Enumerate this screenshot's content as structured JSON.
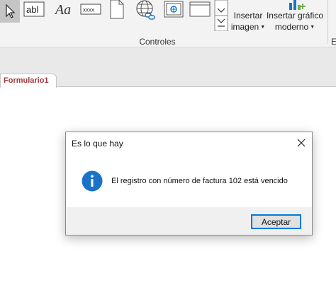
{
  "ribbon": {
    "label_tool_text": "abl",
    "text_tool_text": "Aa",
    "textbox_tool_text": "xxxx",
    "insert_image": {
      "line1": "Insertar",
      "line2": "imagen"
    },
    "insert_chart": {
      "line1": "Insertar gráfico",
      "line2": "moderno"
    },
    "group_label": "Controles",
    "next_group_label": "E",
    "accent_color": "#a4373a"
  },
  "document": {
    "tab_label": "Formulario1"
  },
  "dialog": {
    "title": "Es lo que hay",
    "message": "El registro con número de factura 102 está vencido",
    "ok_label": "Aceptar",
    "icon": "info-icon",
    "icon_color": "#1a73c9"
  }
}
